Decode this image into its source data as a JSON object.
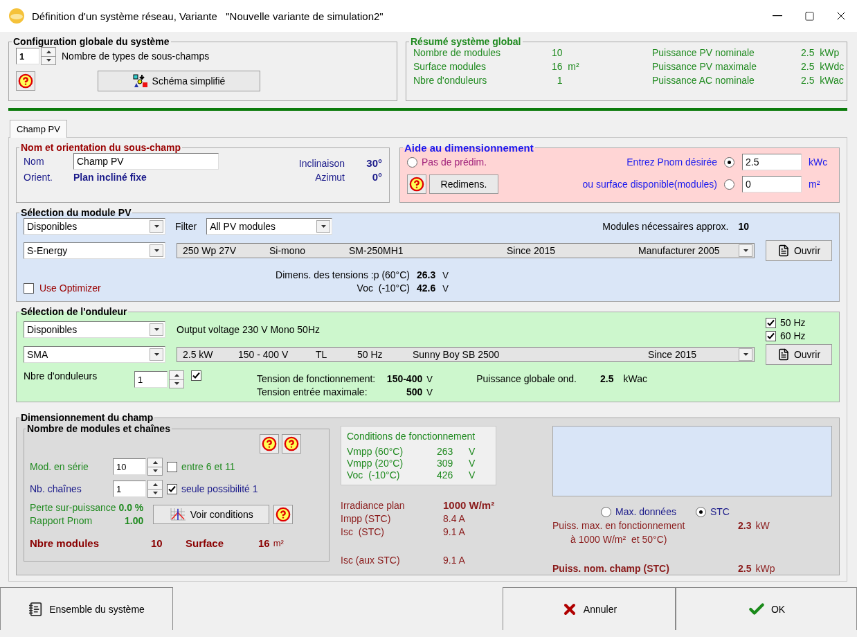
{
  "window": {
    "title": "Définition d'un système réseau, Variante   \"Nouvelle variante de simulation2\""
  },
  "config": {
    "title": "Configuration globale du système",
    "subfield_count": "1",
    "subfield_label": "Nombre de types de sous-champs",
    "schema_button": "Schéma simplifié"
  },
  "summary": {
    "title": "Résumé système global",
    "items": [
      {
        "label": "Nombre de modules",
        "value": "10"
      },
      {
        "label": "Puissance PV nominale",
        "value": "2.5  kWp"
      },
      {
        "label": "Surface modules",
        "value": "16  m²"
      },
      {
        "label": "Puissance PV maximale",
        "value": "2.5  kWdc"
      },
      {
        "label": "Nbre d'onduleurs",
        "value": "  1"
      },
      {
        "label": "Puissance AC nominale",
        "value": "2.5  kWac"
      }
    ]
  },
  "tabs": [
    {
      "label": "Champ PV",
      "selected": true
    }
  ],
  "orientation": {
    "title": "Nom et orientation du sous-champ",
    "name_label": "Nom",
    "name_value": "Champ PV",
    "orient_label": "Orient.",
    "orient_value": "Plan incliné fixe",
    "tilt_label": "Inclinaison",
    "tilt": "30°",
    "azimuth_label": "Azimut",
    "azimuth": "0°"
  },
  "sizing_help": {
    "title": "Aide au dimensionnement",
    "no_presizing": {
      "label": "Pas de prédim.",
      "selected": false
    },
    "options": [
      {
        "label": "Entrez Pnom désirée",
        "selected": true,
        "value": "2.5",
        "unit": "kWc"
      },
      {
        "label": "ou surface disponible(modules)",
        "selected": false,
        "value": "0",
        "unit": "m²"
      }
    ],
    "resize_button": "Redimens."
  },
  "module": {
    "title": "Sélection du module PV",
    "availability": "Disponibles",
    "filter_label": "Filter",
    "filter": "All PV modules",
    "needed_label": "Modules nécessaires approx.",
    "needed": "10",
    "manufacturer": "S-Energy",
    "model_fields": [
      "250 Wp 27V",
      "Si-mono",
      "SM-250MH1",
      "Since 2015",
      "Manufacturer 2005"
    ],
    "open_button": "Ouvrir",
    "optimizer": {
      "label": "Use Optimizer",
      "checked": false
    },
    "voltages": [
      {
        "label": "Dimens. des tensions :p (60°C)",
        "value": "26.3",
        "unit": "V"
      },
      {
        "label": "Voc  (-10°C)",
        "value": "42.6",
        "unit": "V"
      }
    ]
  },
  "inverter": {
    "title": "Sélection de l'onduleur",
    "availability": "Disponibles",
    "output_voltage": "Output voltage 230 V Mono 50Hz",
    "frequencies": [
      {
        "label": "50 Hz",
        "checked": true
      },
      {
        "label": "60 Hz",
        "checked": true
      }
    ],
    "manufacturer": "SMA",
    "model_fields": [
      "2.5 kW",
      "150 - 400 V",
      "TL",
      "50 Hz",
      "Sunny Boy SB 2500",
      "Since 2015"
    ],
    "open_button": "Ouvrir",
    "count_label": "Nbre d'onduleurs",
    "count": "1",
    "count_checked": true,
    "voltages": [
      {
        "label": "Tension de fonctionnement:",
        "value": "150-400",
        "unit": "V"
      },
      {
        "label": "Tension entrée maximale:",
        "value": "500",
        "unit": "V"
      }
    ],
    "global_label": "Puissance globale ond.",
    "global_value": "2.5",
    "global_unit": "kWac"
  },
  "field_sizing": {
    "title": "Dimensionnement du champ",
    "strings": {
      "title": "Nombre de modules et chaînes",
      "rows": [
        {
          "label": "Mod. en série",
          "value": "10",
          "check_label": "entre 6 et 11",
          "checked": false
        },
        {
          "label": "Nb. chaînes",
          "value": "1",
          "check_label": "seule possibilité 1",
          "checked": true
        }
      ],
      "loss_label": "Perte sur-puissance",
      "loss": "0.0 %",
      "ratio_label": "Rapport Pnom",
      "ratio": "1.00",
      "conditions_button": "Voir conditions",
      "modules_label": "Nbre modules",
      "modules": "10",
      "surface_label": "Surface",
      "surface": "16",
      "surface_unit": "m²"
    },
    "conditions": {
      "title": "Conditions de fonctionnement",
      "rows": [
        {
          "label": "Vmpp (60°C)",
          "value": "263",
          "unit": "V"
        },
        {
          "label": "Vmpp (20°C)",
          "value": "309",
          "unit": "V"
        },
        {
          "label": "Voc  (-10°C)",
          "value": "426",
          "unit": "V"
        }
      ]
    },
    "electrical": [
      {
        "label": "Irradiance plan",
        "value": "1000 W/m²",
        "kind": "bold"
      },
      {
        "label": "Impp (STC)",
        "value": "8.4 A",
        "kind": "plain"
      },
      {
        "label": "Isc  (STC)",
        "value": "9.1 A",
        "kind": "plain"
      }
    ],
    "isc_total": {
      "label": "Isc (aux STC)",
      "value": "9.1 A"
    },
    "modes": [
      {
        "label": "Max. données",
        "selected": false
      },
      {
        "label": "STC",
        "selected": true
      }
    ],
    "max_power_label": "Puiss. max. en fonctionnement",
    "max_power": "2.3",
    "max_power_unit": "kW",
    "max_power_note": "à 1000 W/m²  et 50°C)",
    "nominal_label": "Puiss. nom. champ (STC)",
    "nominal": "2.5",
    "nominal_unit": "kWp"
  },
  "buttons": [
    {
      "label": "Ensemble du système",
      "kind": "system"
    },
    {
      "label": "Annuler",
      "kind": "cancel"
    },
    {
      "label": "OK",
      "kind": "ok"
    }
  ]
}
